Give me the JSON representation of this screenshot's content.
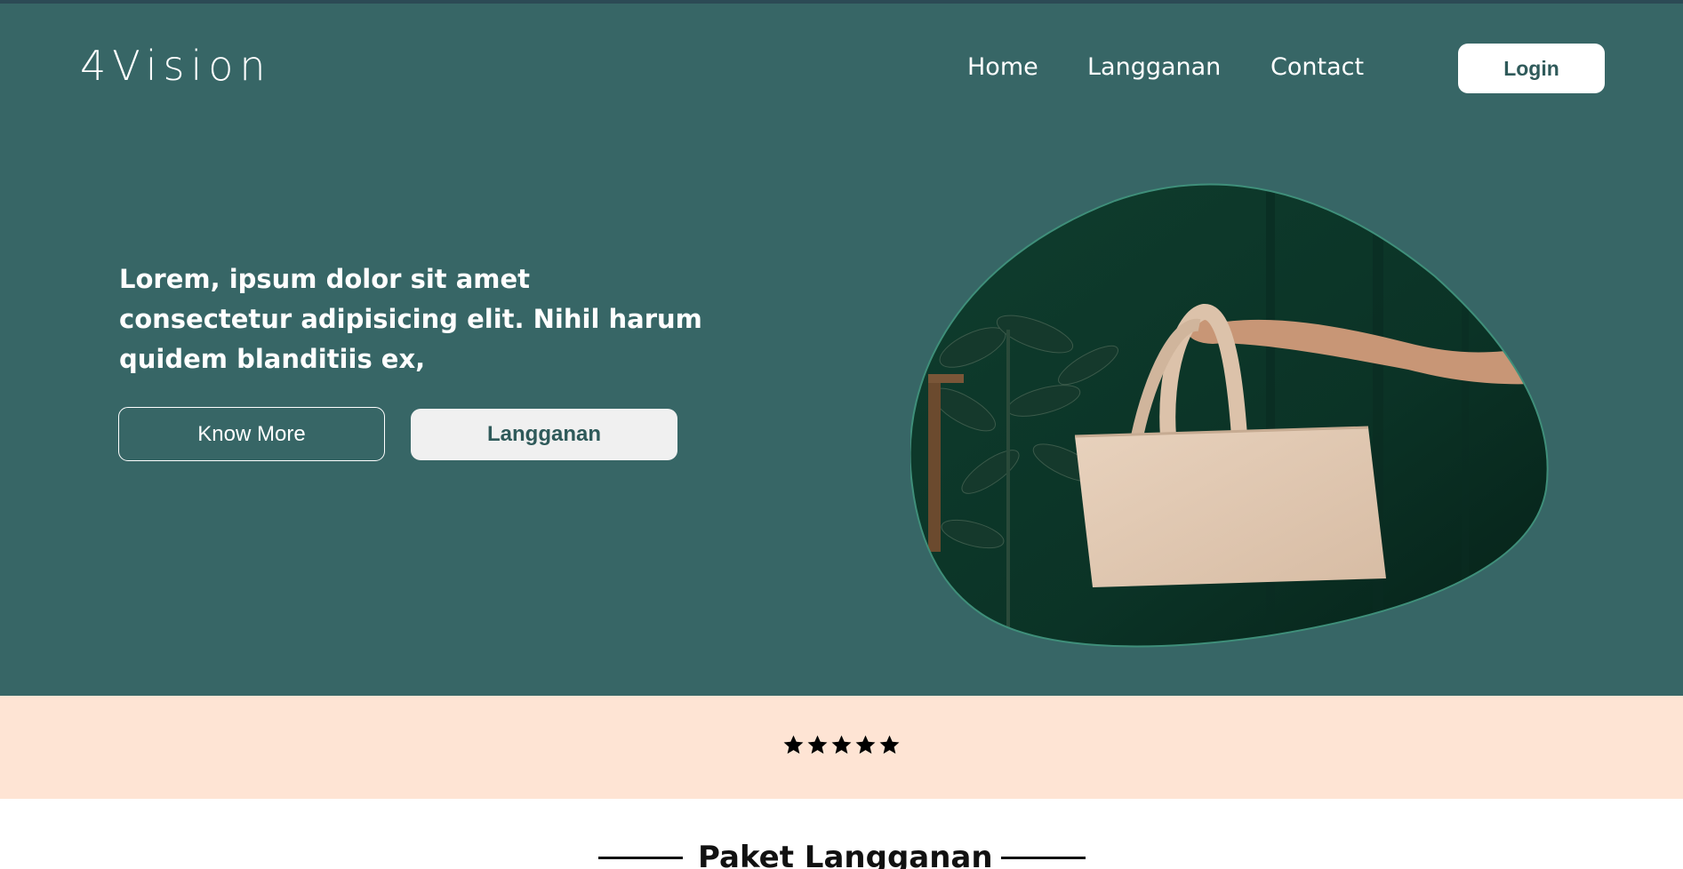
{
  "brand": {
    "logo_text": "4Vision"
  },
  "nav": {
    "items": [
      {
        "label": "Home"
      },
      {
        "label": "Langganan"
      },
      {
        "label": "Contact"
      }
    ],
    "login_label": "Login"
  },
  "hero": {
    "headline": "Lorem, ipsum dolor sit amet consectetur adipisicing elit. Nihil harum quidem blanditiis ex,",
    "primary_button": "Know More",
    "secondary_button": "Langganan",
    "image_icon": "tote-bag-photo"
  },
  "rating": {
    "stars": 5,
    "max_stars": 5
  },
  "section": {
    "title": "Paket Langganan"
  },
  "colors": {
    "hero_bg": "#376666",
    "rating_band_bg": "#fee4d4",
    "button_text": "#2f5a5a"
  }
}
